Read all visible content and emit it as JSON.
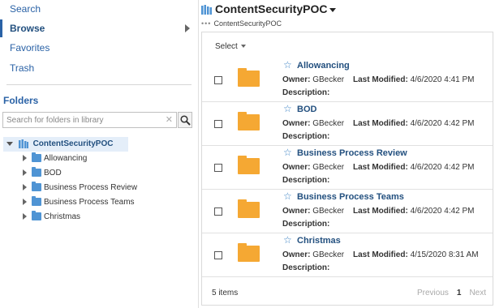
{
  "nav": {
    "items": [
      {
        "label": "Search",
        "active": false
      },
      {
        "label": "Browse",
        "active": true
      },
      {
        "label": "Favorites",
        "active": false
      },
      {
        "label": "Trash",
        "active": false
      }
    ]
  },
  "folders": {
    "heading": "Folders",
    "search_placeholder": "Search for folders in library",
    "tree": {
      "root": "ContentSecurityPOC",
      "children": [
        "Allowancing",
        "BOD",
        "Business Process Review",
        "Business Process Teams",
        "Christmas"
      ]
    }
  },
  "main": {
    "title": "ContentSecurityPOC",
    "breadcrumb": "ContentSecurityPOC",
    "select_label": "Select",
    "labels": {
      "owner": "Owner:",
      "modified": "Last Modified:",
      "description": "Description:"
    },
    "items": [
      {
        "name": "Allowancing",
        "owner": "GBecker",
        "modified": "4/6/2020 4:41 PM"
      },
      {
        "name": "BOD",
        "owner": "GBecker",
        "modified": "4/6/2020 4:42 PM"
      },
      {
        "name": "Business Process Review",
        "owner": "GBecker",
        "modified": "4/6/2020 4:42 PM"
      },
      {
        "name": "Business Process Teams",
        "owner": "GBecker",
        "modified": "4/6/2020 4:42 PM"
      },
      {
        "name": "Christmas",
        "owner": "GBecker",
        "modified": "4/15/2020 8:31 AM"
      }
    ],
    "count_text": "5 items",
    "pager": {
      "previous": "Previous",
      "current": "1",
      "next": "Next"
    }
  },
  "colors": {
    "link": "#2a62a6",
    "folder": "#f5a833",
    "tree_folder": "#4f94d4",
    "selection": "#e4eef9"
  },
  "icons": {
    "search": "magnifier-icon",
    "clear": "clear-x-icon",
    "library": "library-icon",
    "folder": "folder-icon",
    "star": "star-outline-icon"
  }
}
